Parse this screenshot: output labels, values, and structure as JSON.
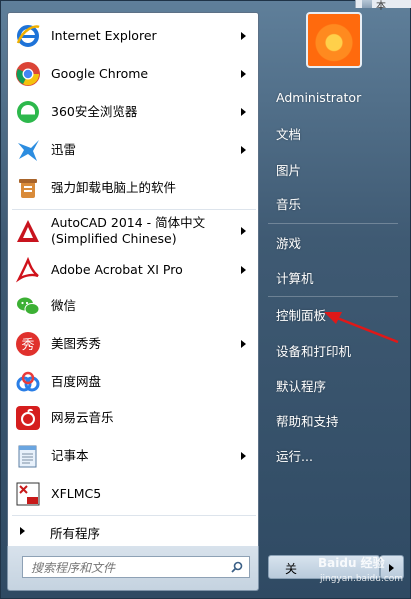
{
  "programs": [
    {
      "label": "Internet Explorer",
      "icon": "ie-icon",
      "submenu": true
    },
    {
      "label": "Google Chrome",
      "icon": "chrome-icon",
      "submenu": true
    },
    {
      "label": "360安全浏览器",
      "icon": "360-browser-icon",
      "submenu": true
    },
    {
      "label": "迅雷",
      "icon": "thunder-icon",
      "submenu": true
    },
    {
      "label": "强力卸载电脑上的软件",
      "icon": "uninstall-icon",
      "submenu": false
    },
    {
      "label": "AutoCAD 2014 - 简体中文 (Simplified Chinese)",
      "icon": "autocad-icon",
      "submenu": true
    },
    {
      "label": "Adobe Acrobat XI Pro",
      "icon": "acrobat-icon",
      "submenu": true
    },
    {
      "label": "微信",
      "icon": "wechat-icon",
      "submenu": false
    },
    {
      "label": "美图秀秀",
      "icon": "meitu-icon",
      "submenu": true
    },
    {
      "label": "百度网盘",
      "icon": "baidu-netdisk-icon",
      "submenu": false
    },
    {
      "label": "网易云音乐",
      "icon": "netease-music-icon",
      "submenu": false
    },
    {
      "label": "记事本",
      "icon": "notepad-icon",
      "submenu": true
    },
    {
      "label": "XFLMC5",
      "icon": "xflmc5-icon",
      "submenu": false
    }
  ],
  "all_programs": "所有程序",
  "search": {
    "placeholder": "搜索程序和文件"
  },
  "right": {
    "user": "Administrator",
    "documents": "文档",
    "pictures": "图片",
    "music": "音乐",
    "games": "游戏",
    "computer": "计算机",
    "control_panel": "控制面板",
    "devices_printers": "设备和打印机",
    "default_programs": "默认程序",
    "help_support": "帮助和支持",
    "run": "运行..."
  },
  "shutdown": {
    "label": "关"
  },
  "watermark": {
    "main": "Baidu 经验",
    "sub": "jingyan.baidu.com"
  },
  "background_partial_text": "本"
}
